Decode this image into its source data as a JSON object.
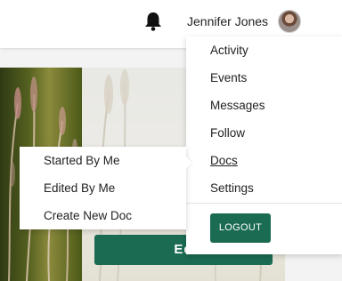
{
  "header": {
    "username": "Jennifer Jones",
    "bell_icon": "bell-icon",
    "avatar_icon": "user-avatar"
  },
  "hero": {
    "button_label": "Ed"
  },
  "dropdown": {
    "items": [
      {
        "label": "Activity"
      },
      {
        "label": "Events"
      },
      {
        "label": "Messages"
      },
      {
        "label": "Follow"
      },
      {
        "label": "Docs"
      },
      {
        "label": "Settings"
      }
    ],
    "logout_label": "LOGOUT"
  },
  "docs_submenu": {
    "items": [
      {
        "label": "Started By Me"
      },
      {
        "label": "Edited By Me"
      },
      {
        "label": "Create New Doc"
      }
    ]
  },
  "colors": {
    "accent": "#1b6b52"
  }
}
